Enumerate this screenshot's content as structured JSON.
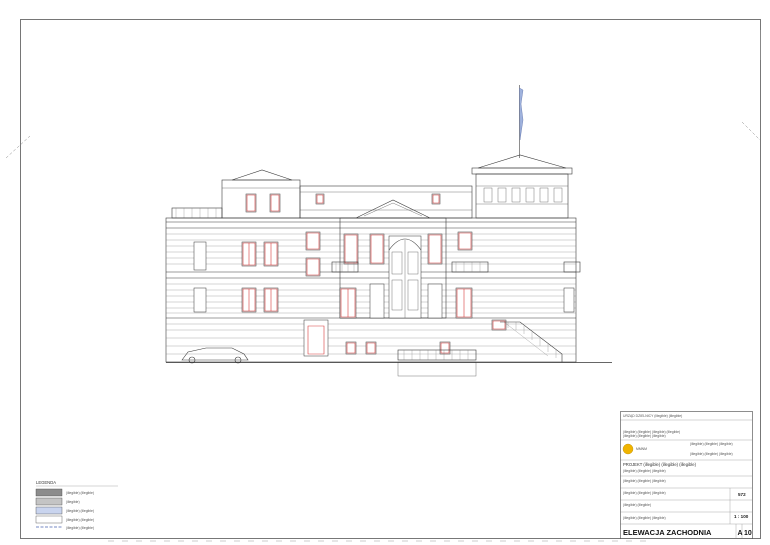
{
  "title_block": {
    "logo_caption": "MMNM",
    "lines": [
      "URZĄD DZIELNICY (illegible) (illegible)",
      "(illegible) (illegible) (illegible) (illegible)",
      "(illegible) (illegible) (illegible)",
      "(illegible) (illegible) (illegible)",
      "(illegible) (illegible) (illegible)",
      "PROJEKT (illegible) (illegible) (illegible)",
      "(illegible) (illegible) (illegible)",
      "(illegible) (illegible) (illegible)",
      "(illegible) (illegible) (illegible)",
      "(illegible) (illegible)",
      "(illegible) (illegible) (illegible)"
    ],
    "sheet_code": "572",
    "scale": "1 : 100",
    "drawing_title": "ELEWACJA ZACHODNIA",
    "sheet_prefix": "A",
    "sheet_number": "10"
  },
  "legend": {
    "header": "LEGENDA",
    "items": [
      {
        "label": "(illegible) (illegible)",
        "color": "#8c8c8c"
      },
      {
        "label": "(illegible)",
        "color": "#c4c4c4"
      },
      {
        "label": "(illegible) (illegible)",
        "color": "#c9d4ee"
      },
      {
        "label": "(illegible) (illegible)",
        "color": "#ffffff"
      }
    ],
    "line_item": "(illegible) (illegible)"
  }
}
